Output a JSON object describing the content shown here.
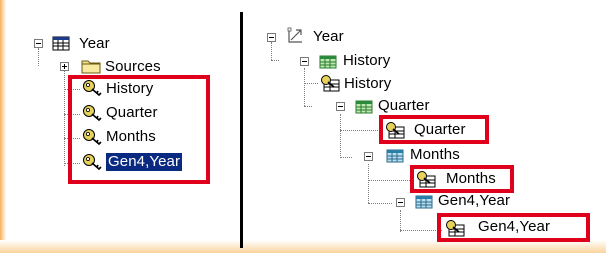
{
  "colors": {
    "background": "#ffffff",
    "highlight_box": "#e0001b",
    "selection": "#0a2a82",
    "divider": "#000000",
    "watermark_orange": "#f7b05a"
  },
  "left_panel": {
    "nodes": [
      {
        "label": "Year",
        "icon": "table-icon",
        "expander": "minus"
      },
      {
        "label": "Sources",
        "icon": "folder-icon",
        "expander": "plus"
      },
      {
        "label": "History",
        "icon": "key-icon"
      },
      {
        "label": "Quarter",
        "icon": "key-icon"
      },
      {
        "label": "Months",
        "icon": "key-icon"
      },
      {
        "label": "Gen4,Year",
        "icon": "key-icon",
        "selected": true
      }
    ]
  },
  "right_panel": {
    "nodes": [
      {
        "label": "Year",
        "icon": "hierarchy-icon",
        "expander": "minus"
      },
      {
        "label": "History",
        "icon": "level-table-icon",
        "expander": "minus"
      },
      {
        "label": "History",
        "icon": "key-table-icon"
      },
      {
        "label": "Quarter",
        "icon": "level-table-icon",
        "expander": "minus"
      },
      {
        "label": "Quarter",
        "icon": "key-table-icon"
      },
      {
        "label": "Months",
        "icon": "level-table-icon",
        "expander": "minus"
      },
      {
        "label": "Months",
        "icon": "key-table-icon"
      },
      {
        "label": "Gen4,Year",
        "icon": "level-table-icon",
        "expander": "minus"
      },
      {
        "label": "Gen4,Year",
        "icon": "key-table-icon"
      }
    ]
  }
}
